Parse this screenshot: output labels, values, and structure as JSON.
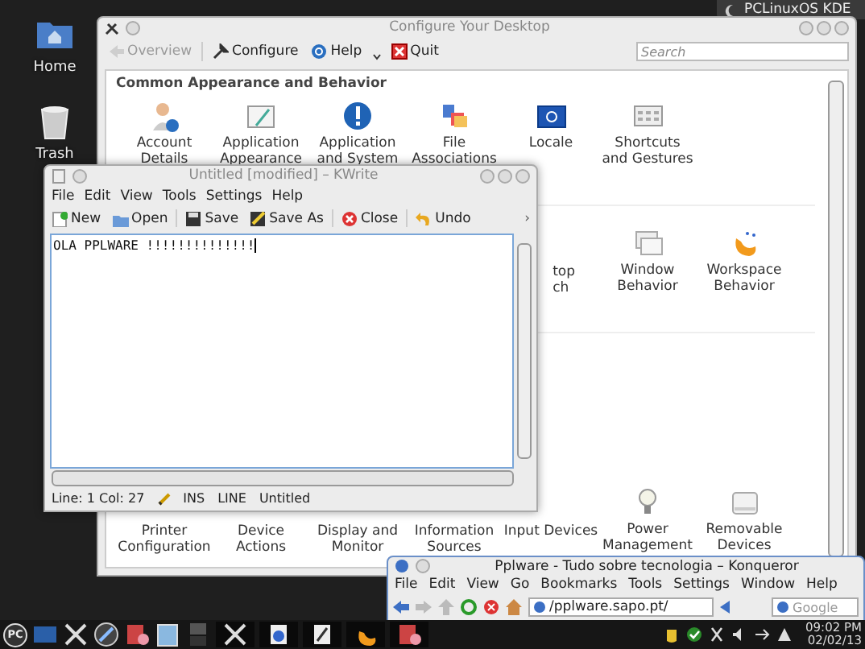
{
  "top_panel": {
    "label": "PCLinuxOS KDE"
  },
  "desktop_icons": [
    {
      "label": "Home"
    },
    {
      "label": "Trash"
    }
  ],
  "configure_window": {
    "title": "Configure Your Desktop",
    "toolbar": [
      {
        "label": "Overview",
        "disabled": true
      },
      {
        "label": "Configure",
        "disabled": false
      },
      {
        "label": "Help",
        "disabled": false
      },
      {
        "label": "Quit",
        "disabled": false
      }
    ],
    "search": {
      "placeholder": "Search"
    },
    "section": "Common Appearance and Behavior",
    "rows": [
      [
        {
          "label": "Account\nDetails"
        },
        {
          "label": "Application\nAppearance"
        },
        {
          "label": "Application\nand System"
        },
        {
          "label": "File\nAssociations"
        },
        {
          "label": "Locale"
        },
        {
          "label": "Shortcuts\nand Gestures"
        }
      ],
      [
        null,
        null,
        null,
        null,
        {
          "label": "top\nch"
        },
        {
          "label": "Window\nBehavior"
        },
        {
          "label": "Workspace\nBehavior"
        }
      ],
      [
        {
          "label": "Printer\nConfiguration"
        },
        {
          "label": "Device\nActions"
        },
        {
          "label": "Display and\nMonitor"
        },
        {
          "label": "Information\nSources"
        },
        {
          "label": "Input Devices"
        },
        {
          "label": "Power\nManagement"
        },
        {
          "label": "Removable\nDevices"
        }
      ]
    ]
  },
  "kwrite": {
    "title": "Untitled [modified] – KWrite",
    "menu": [
      "File",
      "Edit",
      "View",
      "Tools",
      "Settings",
      "Help"
    ],
    "toolbar": [
      "New",
      "Open",
      "Save",
      "Save As",
      "Close",
      "Undo"
    ],
    "overflow": "›",
    "text": "OLA PPLWARE !!!!!!!!!!!!!!",
    "status": [
      "Line: 1 Col: 27",
      "INS",
      "LINE",
      "Untitled"
    ]
  },
  "konqueror": {
    "title": "Pplware - Tudo sobre tecnologia – Konqueror",
    "menu": [
      "File",
      "Edit",
      "View",
      "Go",
      "Bookmarks",
      "Tools",
      "Settings",
      "Window",
      "Help"
    ],
    "address": "/pplware.sapo.pt/",
    "search": {
      "placeholder": "Google"
    }
  },
  "taskbar": {
    "start_label": "PC",
    "time": "09:02 PM",
    "date": "02/02/13"
  }
}
